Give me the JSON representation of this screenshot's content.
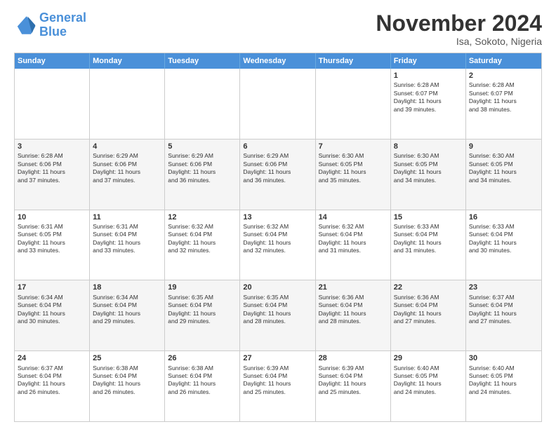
{
  "logo": {
    "line1": "General",
    "line2": "Blue"
  },
  "title": "November 2024",
  "location": "Isa, Sokoto, Nigeria",
  "header_days": [
    "Sunday",
    "Monday",
    "Tuesday",
    "Wednesday",
    "Thursday",
    "Friday",
    "Saturday"
  ],
  "rows": [
    [
      {
        "day": "",
        "info": "",
        "empty": true
      },
      {
        "day": "",
        "info": "",
        "empty": true
      },
      {
        "day": "",
        "info": "",
        "empty": true
      },
      {
        "day": "",
        "info": "",
        "empty": true
      },
      {
        "day": "",
        "info": "",
        "empty": true
      },
      {
        "day": "1",
        "info": "Sunrise: 6:28 AM\nSunset: 6:07 PM\nDaylight: 11 hours\nand 39 minutes."
      },
      {
        "day": "2",
        "info": "Sunrise: 6:28 AM\nSunset: 6:07 PM\nDaylight: 11 hours\nand 38 minutes."
      }
    ],
    [
      {
        "day": "3",
        "info": "Sunrise: 6:28 AM\nSunset: 6:06 PM\nDaylight: 11 hours\nand 37 minutes."
      },
      {
        "day": "4",
        "info": "Sunrise: 6:29 AM\nSunset: 6:06 PM\nDaylight: 11 hours\nand 37 minutes."
      },
      {
        "day": "5",
        "info": "Sunrise: 6:29 AM\nSunset: 6:06 PM\nDaylight: 11 hours\nand 36 minutes."
      },
      {
        "day": "6",
        "info": "Sunrise: 6:29 AM\nSunset: 6:06 PM\nDaylight: 11 hours\nand 36 minutes."
      },
      {
        "day": "7",
        "info": "Sunrise: 6:30 AM\nSunset: 6:05 PM\nDaylight: 11 hours\nand 35 minutes."
      },
      {
        "day": "8",
        "info": "Sunrise: 6:30 AM\nSunset: 6:05 PM\nDaylight: 11 hours\nand 34 minutes."
      },
      {
        "day": "9",
        "info": "Sunrise: 6:30 AM\nSunset: 6:05 PM\nDaylight: 11 hours\nand 34 minutes."
      }
    ],
    [
      {
        "day": "10",
        "info": "Sunrise: 6:31 AM\nSunset: 6:05 PM\nDaylight: 11 hours\nand 33 minutes."
      },
      {
        "day": "11",
        "info": "Sunrise: 6:31 AM\nSunset: 6:04 PM\nDaylight: 11 hours\nand 33 minutes."
      },
      {
        "day": "12",
        "info": "Sunrise: 6:32 AM\nSunset: 6:04 PM\nDaylight: 11 hours\nand 32 minutes."
      },
      {
        "day": "13",
        "info": "Sunrise: 6:32 AM\nSunset: 6:04 PM\nDaylight: 11 hours\nand 32 minutes."
      },
      {
        "day": "14",
        "info": "Sunrise: 6:32 AM\nSunset: 6:04 PM\nDaylight: 11 hours\nand 31 minutes."
      },
      {
        "day": "15",
        "info": "Sunrise: 6:33 AM\nSunset: 6:04 PM\nDaylight: 11 hours\nand 31 minutes."
      },
      {
        "day": "16",
        "info": "Sunrise: 6:33 AM\nSunset: 6:04 PM\nDaylight: 11 hours\nand 30 minutes."
      }
    ],
    [
      {
        "day": "17",
        "info": "Sunrise: 6:34 AM\nSunset: 6:04 PM\nDaylight: 11 hours\nand 30 minutes."
      },
      {
        "day": "18",
        "info": "Sunrise: 6:34 AM\nSunset: 6:04 PM\nDaylight: 11 hours\nand 29 minutes."
      },
      {
        "day": "19",
        "info": "Sunrise: 6:35 AM\nSunset: 6:04 PM\nDaylight: 11 hours\nand 29 minutes."
      },
      {
        "day": "20",
        "info": "Sunrise: 6:35 AM\nSunset: 6:04 PM\nDaylight: 11 hours\nand 28 minutes."
      },
      {
        "day": "21",
        "info": "Sunrise: 6:36 AM\nSunset: 6:04 PM\nDaylight: 11 hours\nand 28 minutes."
      },
      {
        "day": "22",
        "info": "Sunrise: 6:36 AM\nSunset: 6:04 PM\nDaylight: 11 hours\nand 27 minutes."
      },
      {
        "day": "23",
        "info": "Sunrise: 6:37 AM\nSunset: 6:04 PM\nDaylight: 11 hours\nand 27 minutes."
      }
    ],
    [
      {
        "day": "24",
        "info": "Sunrise: 6:37 AM\nSunset: 6:04 PM\nDaylight: 11 hours\nand 26 minutes."
      },
      {
        "day": "25",
        "info": "Sunrise: 6:38 AM\nSunset: 6:04 PM\nDaylight: 11 hours\nand 26 minutes."
      },
      {
        "day": "26",
        "info": "Sunrise: 6:38 AM\nSunset: 6:04 PM\nDaylight: 11 hours\nand 26 minutes."
      },
      {
        "day": "27",
        "info": "Sunrise: 6:39 AM\nSunset: 6:04 PM\nDaylight: 11 hours\nand 25 minutes."
      },
      {
        "day": "28",
        "info": "Sunrise: 6:39 AM\nSunset: 6:04 PM\nDaylight: 11 hours\nand 25 minutes."
      },
      {
        "day": "29",
        "info": "Sunrise: 6:40 AM\nSunset: 6:05 PM\nDaylight: 11 hours\nand 24 minutes."
      },
      {
        "day": "30",
        "info": "Sunrise: 6:40 AM\nSunset: 6:05 PM\nDaylight: 11 hours\nand 24 minutes."
      }
    ]
  ]
}
